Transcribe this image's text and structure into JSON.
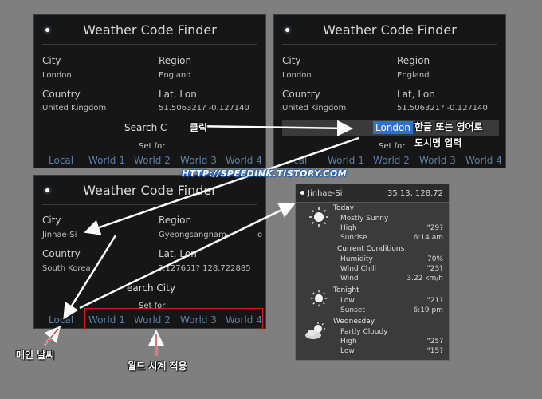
{
  "app": {
    "title": "Weather Code Finder"
  },
  "labels": {
    "city": "City",
    "region": "Region",
    "country": "Country",
    "latlon": "Lat, Lon",
    "search": "Search City",
    "setfor": "Set for"
  },
  "panel1": {
    "city": "London",
    "region": "England",
    "country": "United Kingdom",
    "latlon": "51.506321? -0.127140",
    "search_partial": "Search C"
  },
  "panel2": {
    "city": "London",
    "region": "England",
    "country": "United Kingdom",
    "latlon": "51.506321? -0.127140",
    "search_value": "London",
    "local_partial": "cal"
  },
  "panel3": {
    "city": "Jinhae-Si",
    "region_partial": "Gyeongsangnam-",
    "region_tail": "o",
    "country": "South Korea",
    "latlon_partial": "?.127651? 128.722885",
    "search_partial": "earch City"
  },
  "tabs": [
    "Local",
    "World 1",
    "World 2",
    "World 3",
    "World 4"
  ],
  "annotations": {
    "click": "클릭",
    "input_line1": "한글 또는 영어로",
    "input_line2": "도시명 입력",
    "main_weather": "메인 날씨",
    "world_clock": "월드 시계 적용",
    "url": "HTTP://SPEEDINK.TISTORY.COM"
  },
  "widget": {
    "city": "Jinhae-Si",
    "coords": "35.13, 128.72",
    "today": {
      "title": "Today",
      "condition": "Mostly Sunny",
      "high_label": "High",
      "high": "\"29?",
      "sunrise_label": "Sunrise",
      "sunrise": "6:14 am"
    },
    "current": {
      "title": "Current Conditions",
      "humidity_label": "Humidity",
      "humidity": "70%",
      "windchill_label": "Wind Chill",
      "windchill": "\"23?",
      "wind_label": "Wind",
      "wind": "3.22 km/h"
    },
    "tonight": {
      "title": "Tonight",
      "low_label": "Low",
      "low": "\"21?",
      "sunset_label": "Sunset",
      "sunset": "6:19 pm"
    },
    "wednesday": {
      "title": "Wednesday",
      "condition": "Partly Cloudy",
      "high_label": "High",
      "high": "\"25?",
      "low_label": "Low",
      "low": "\"15?"
    }
  },
  "colors": {
    "background": "#7f7f7f",
    "panel": "#161616",
    "tab": "#5a7ea8",
    "highlight": "#2f6fcf",
    "redbox": "#e0141a"
  }
}
